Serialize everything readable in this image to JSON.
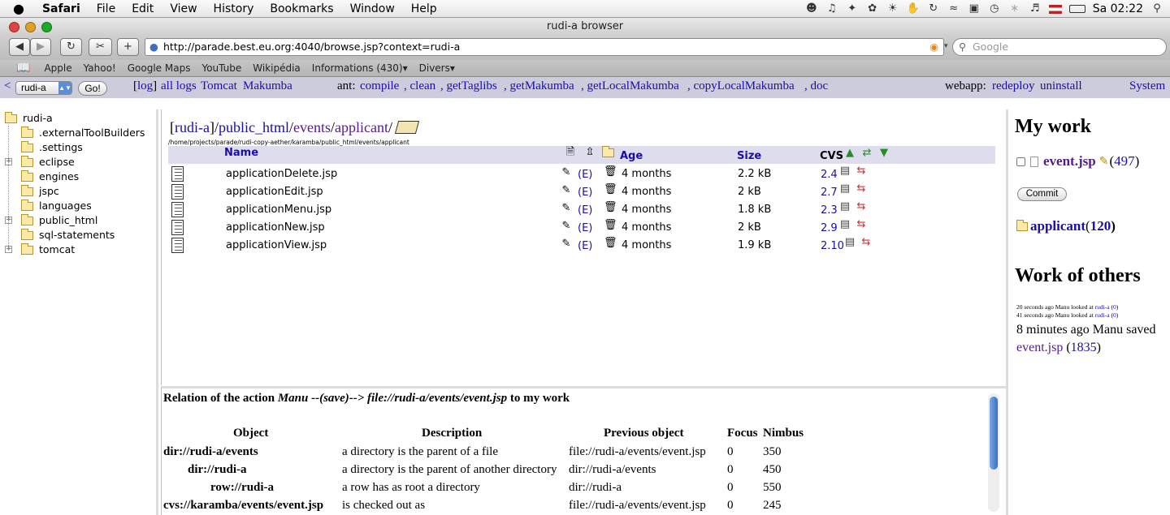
{
  "menubar": {
    "apple": "",
    "app": "Safari",
    "items": [
      "File",
      "Edit",
      "View",
      "History",
      "Bookmarks",
      "Window",
      "Help"
    ],
    "clock": "Sa 02:22"
  },
  "window": {
    "title": "rudi-a browser"
  },
  "toolbar": {
    "url": "http://parade.best.eu.org:4040/browse.jsp?context=rudi-a",
    "search_placeholder": "Google"
  },
  "bookmarks": [
    "Apple",
    "Yahoo!",
    "Google Maps",
    "YouTube",
    "Wikipédia",
    "Informations (430)▾",
    "Divers▾"
  ],
  "appbar": {
    "back": "<",
    "context": "rudi-a",
    "go": "Go!",
    "log_open": "[",
    "log": "log",
    "log_close": "]",
    "all_logs": "all logs",
    "tomcat": "Tomcat",
    "makumba": "Makumba",
    "ant_label": "ant:",
    "ant": [
      "compile",
      ", clean",
      ", getTaglibs",
      ", getMakumba",
      ", getLocalMakumba",
      ", copyLocalMakumba",
      ", doc"
    ],
    "webapp_label": "webapp:",
    "redeploy": "redeploy",
    "uninstall": "uninstall",
    "system": "System"
  },
  "tree": {
    "root": "rudi-a",
    "items": [
      {
        "label": ".externalToolBuilders",
        "expandable": false
      },
      {
        "label": ".settings",
        "expandable": false
      },
      {
        "label": "eclipse",
        "expandable": true
      },
      {
        "label": "engines",
        "expandable": false
      },
      {
        "label": "jspc",
        "expandable": false
      },
      {
        "label": "languages",
        "expandable": false
      },
      {
        "label": "public_html",
        "expandable": true
      },
      {
        "label": "sql-statements",
        "expandable": false
      },
      {
        "label": "tomcat",
        "expandable": true
      }
    ]
  },
  "main": {
    "breadcrumb": {
      "open": "[",
      "b0": "rudi-a",
      "sep0": "]/",
      "b1": "public_html",
      "sep1": "/",
      "b2": "events",
      "sep2": "/",
      "b3": "applicant",
      "sep3": "/"
    },
    "path": "/home/projects/parade/rudi-copy-aether/karamba/public_html/events/applicant",
    "headers": {
      "name": "Name",
      "age": "Age",
      "size": "Size",
      "cvs": "CVS"
    },
    "files": [
      {
        "name": "applicationDelete.jsp",
        "edit": "(E)",
        "age": "4 months",
        "size": "2.2 kB",
        "cvs": "2.4"
      },
      {
        "name": "applicationEdit.jsp",
        "edit": "(E)",
        "age": "4 months",
        "size": "2 kB",
        "cvs": "2.7"
      },
      {
        "name": "applicationMenu.jsp",
        "edit": "(E)",
        "age": "4 months",
        "size": "1.8 kB",
        "cvs": "2.3"
      },
      {
        "name": "applicationNew.jsp",
        "edit": "(E)",
        "age": "4 months",
        "size": "2 kB",
        "cvs": "2.9"
      },
      {
        "name": "applicationView.jsp",
        "edit": "(E)",
        "age": "4 months",
        "size": "1.9 kB",
        "cvs": "2.10"
      }
    ]
  },
  "relation": {
    "title_pre": "Relation of the action ",
    "title_actor": "Manu --(save)--> file://rudi-a/events/event.jsp",
    "title_post": " to my work",
    "headers": [
      "Object",
      "Description",
      "Previous object",
      "Focus",
      "Nimbus"
    ],
    "rows": [
      {
        "object": "dir://rudi-a/events",
        "description": "a directory is the parent of a file",
        "previous": "file://rudi-a/events/event.jsp",
        "focus": "0",
        "nimbus": "350"
      },
      {
        "object": "dir://rudi-a",
        "description": "a directory is the parent of another directory",
        "previous": "dir://rudi-a/events",
        "focus": "0",
        "nimbus": "450"
      },
      {
        "object": "row://rudi-a",
        "description": "a row has as root a directory",
        "previous": "dir://rudi-a",
        "focus": "0",
        "nimbus": "550"
      },
      {
        "object": "cvs://karamba/events/event.jsp",
        "description": "is checked out as",
        "previous": "file://rudi-a/events/event.jsp",
        "focus": "0",
        "nimbus": "245"
      }
    ]
  },
  "side": {
    "my_work": "My work",
    "file": "event.jsp",
    "file_open": "(",
    "file_count": "497",
    "file_close": ")",
    "commit": "Commit",
    "dir": "applicant",
    "dir_open": "(",
    "dir_count": "120",
    "dir_close": ")",
    "others_title": "Work of others",
    "small1_text": "20 seconds ago Manu looked at ",
    "small1_link": "rudi-a",
    "small1_open": " (",
    "small1_count": "0",
    "small1_close": ")",
    "small2_text": "41 seconds ago Manu looked at ",
    "small2_link": "rudi-a",
    "small2_open": " (",
    "small2_count": "0",
    "small2_close": ")",
    "saved_text": "8 minutes ago Manu saved ",
    "saved_link": "event.jsp",
    "saved_open": " (",
    "saved_count": "1835",
    "saved_close": ")"
  }
}
